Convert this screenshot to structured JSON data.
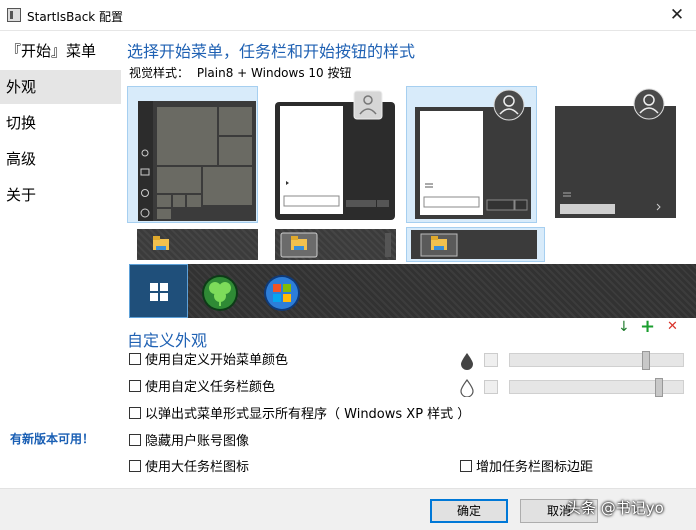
{
  "window": {
    "title": "StartIsBack 配置",
    "close": "✕"
  },
  "sidebar": {
    "items": [
      {
        "label": "『开始』菜单"
      },
      {
        "label": "外观"
      },
      {
        "label": "切换"
      },
      {
        "label": "高级"
      },
      {
        "label": "关于"
      }
    ],
    "update_notice": "有新版本可用！"
  },
  "main": {
    "heading": "选择开始菜单，任务栏和开始按钮的样式",
    "visual_style_label": "视觉样式：",
    "visual_style_value": "Plain8 + Windows 10 按钮",
    "custom_heading": "自定义外观",
    "options": [
      {
        "label": "使用自定义开始菜单颜色",
        "checked": false
      },
      {
        "label": "使用自定义任务栏颜色",
        "checked": false
      },
      {
        "label": "以弹出式菜单形式显示所有程序（ Windows XP 样式 ）",
        "checked": false
      },
      {
        "label": "隐藏用户账号图像",
        "checked": false
      },
      {
        "label": "使用大任务栏图标",
        "checked": false
      },
      {
        "label": "增加任务栏图标边距",
        "checked": false
      }
    ],
    "sliders": [
      {
        "value": 0.8
      },
      {
        "value": 0.88
      }
    ],
    "icons": {
      "download": "↓",
      "add": "+",
      "remove": "✕"
    }
  },
  "footer": {
    "ok": "确定",
    "cancel": "取消",
    "watermark": "头条 @书记yo"
  },
  "colors": {
    "accent": "#1f61b3",
    "selection": "#d8ebfa",
    "update_link": "#1a5fb4"
  }
}
